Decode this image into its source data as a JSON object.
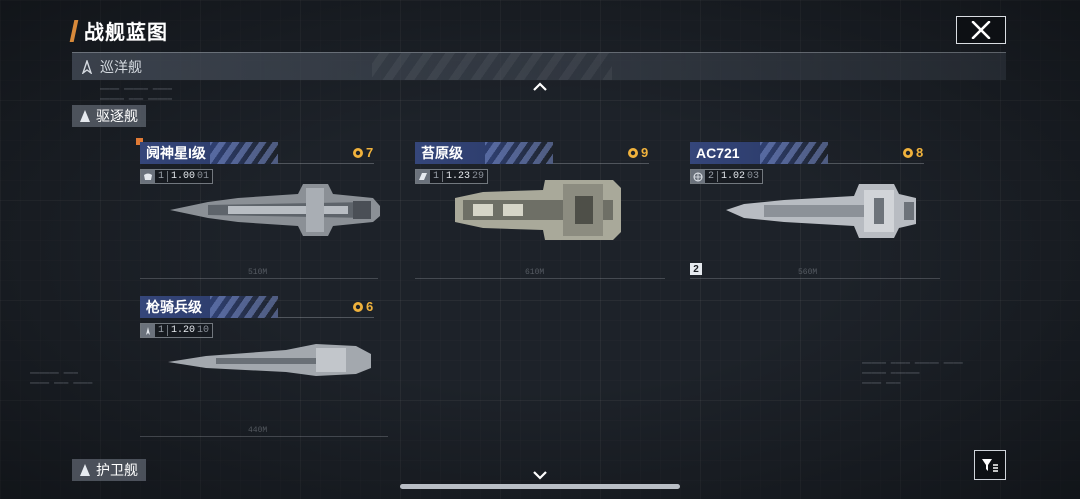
{
  "page": {
    "title": "战舰蓝图",
    "accent_color": "#d7893a"
  },
  "categories": {
    "cruiser": {
      "label": "巡洋舰"
    },
    "destroyer": {
      "label": "驱逐舰"
    },
    "frigate": {
      "label": "护卫舰"
    }
  },
  "ships": [
    {
      "name": "阋神星I级",
      "count": "7",
      "tier": "1",
      "version": "1.00",
      "sub": "01",
      "icon": "shield-stat-icon",
      "length_label": "510M"
    },
    {
      "name": "苔原级",
      "count": "9",
      "tier": "1",
      "version": "1.23",
      "sub": "29",
      "icon": "wing-stat-icon",
      "length_label": "610M"
    },
    {
      "name": "AC721",
      "count": "8",
      "tier": "2",
      "version": "1.02",
      "sub": "03",
      "icon": "globe-stat-icon",
      "length_label": "560M",
      "variant_badge": "2"
    },
    {
      "name": "枪骑兵级",
      "count": "6",
      "tier": "1",
      "version": "1.20",
      "sub": "10",
      "icon": "fighter-stat-icon",
      "length_label": "440M"
    }
  ],
  "colors": {
    "count": "#f0b23c",
    "card_header": "#35467a",
    "marker": "#e07a35"
  }
}
